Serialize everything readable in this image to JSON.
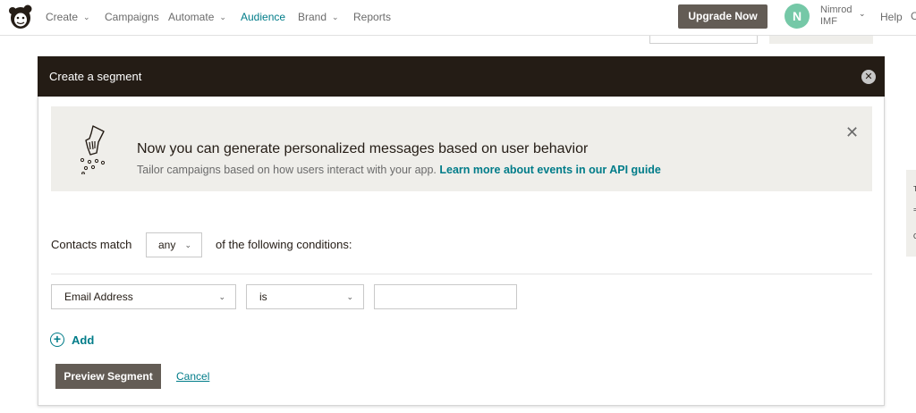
{
  "nav": {
    "items": [
      {
        "label": "Create",
        "has_dropdown": true
      },
      {
        "label": "Campaigns",
        "has_dropdown": false
      },
      {
        "label": "Automate",
        "has_dropdown": true
      },
      {
        "label": "Audience",
        "has_dropdown": false,
        "active": true
      },
      {
        "label": "Brand",
        "has_dropdown": true
      },
      {
        "label": "Reports",
        "has_dropdown": false
      }
    ],
    "upgrade_label": "Upgrade Now",
    "user": {
      "initial": "N",
      "name": "Nimrod",
      "org": "IMF"
    },
    "help_label": "Help",
    "help_extra": "C"
  },
  "side_tab": {
    "line1": "T",
    "line2": "=",
    "line3": "C"
  },
  "modal": {
    "title": "Create a segment",
    "banner": {
      "title": "Now you can generate personalized messages based on user behavior",
      "text": "Tailor campaigns based on how users interact with your app.",
      "link": "Learn more about events in our API guide"
    },
    "match": {
      "prefix": "Contacts match",
      "selected": "any",
      "suffix": "of the following conditions:"
    },
    "condition": {
      "field": "Email Address",
      "operator": "is",
      "value": ""
    },
    "add_label": "Add",
    "preview_label": "Preview Segment",
    "cancel_label": "Cancel"
  },
  "colors": {
    "accent": "#007c89",
    "header_bg": "#241c15",
    "button_bg": "#635c55",
    "banner_bg": "#efeeea",
    "avatar_bg": "#75c8a7"
  }
}
